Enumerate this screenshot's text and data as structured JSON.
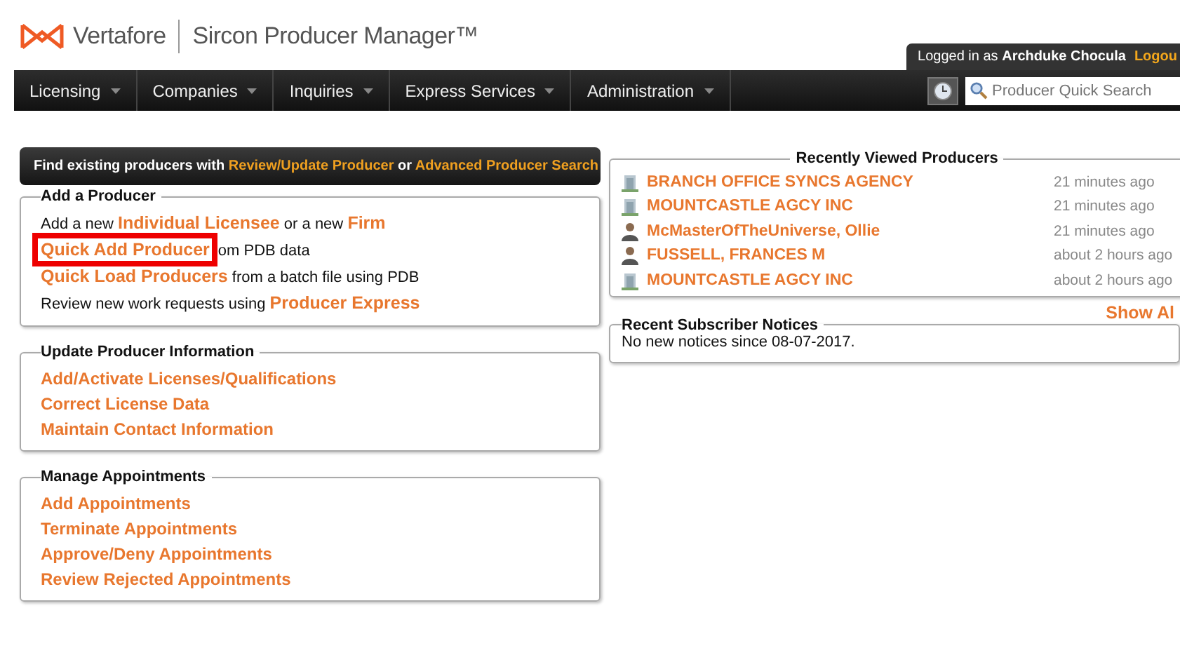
{
  "header": {
    "brand": "Vertafore",
    "product": "Sircon",
    "product_suffix": "Producer Manager",
    "trademark": "™",
    "login_prefix": "Logged in as",
    "user": "Archduke Chocula",
    "logout": "Logou"
  },
  "nav": [
    {
      "label": "Licensing"
    },
    {
      "label": "Companies"
    },
    {
      "label": "Inquiries"
    },
    {
      "label": "Express Services"
    },
    {
      "label": "Administration"
    }
  ],
  "search": {
    "placeholder": "Producer Quick Search"
  },
  "find_bar": {
    "parts": [
      {
        "kind": "text",
        "text": "Find existing producers with "
      },
      {
        "kind": "link",
        "text": "Review/Update Producer"
      },
      {
        "kind": "text",
        "text": " or "
      },
      {
        "kind": "link",
        "text": "Advanced Producer Search"
      }
    ]
  },
  "sections": [
    {
      "title": "Add a Producer",
      "lines": [
        {
          "parts": [
            {
              "kind": "text",
              "text": "Add a new "
            },
            {
              "kind": "link",
              "text": "Individual Licensee",
              "highlighted": false
            },
            {
              "kind": "text",
              "text": " or a new "
            },
            {
              "kind": "link",
              "text": "Firm",
              "highlighted": false
            }
          ]
        },
        {
          "parts": [
            {
              "kind": "link",
              "text": "Quick Add Producer",
              "highlighted": true
            },
            {
              "kind": "text",
              "text": "om PDB data"
            }
          ]
        },
        {
          "parts": [
            {
              "kind": "link",
              "text": "Quick Load Producers",
              "highlighted": false
            },
            {
              "kind": "text",
              "text": " from a batch file using PDB"
            }
          ]
        },
        {
          "parts": [
            {
              "kind": "text",
              "text": "Review new work requests using "
            },
            {
              "kind": "link",
              "text": "Producer Express",
              "highlighted": false
            }
          ]
        }
      ]
    },
    {
      "title": "Update Producer Information",
      "lines": [
        {
          "parts": [
            {
              "kind": "link",
              "text": "Add/Activate Licenses/Qualifications",
              "highlighted": false
            }
          ]
        },
        {
          "parts": [
            {
              "kind": "link",
              "text": "Correct License Data",
              "highlighted": false
            }
          ]
        },
        {
          "parts": [
            {
              "kind": "link",
              "text": "Maintain Contact Information",
              "highlighted": false
            }
          ]
        }
      ]
    },
    {
      "title": "Manage Appointments",
      "lines": [
        {
          "parts": [
            {
              "kind": "link",
              "text": "Add Appointments",
              "highlighted": false
            }
          ]
        },
        {
          "parts": [
            {
              "kind": "link",
              "text": "Terminate Appointments",
              "highlighted": false
            }
          ]
        },
        {
          "parts": [
            {
              "kind": "link",
              "text": "Approve/Deny Appointments",
              "highlighted": false
            }
          ]
        },
        {
          "parts": [
            {
              "kind": "link",
              "text": "Review Rejected Appointments",
              "highlighted": false
            }
          ]
        }
      ]
    }
  ],
  "recent": {
    "title": "Recently Viewed Producers",
    "items": [
      {
        "kind": "firm",
        "name": "BRANCH OFFICE SYNCS AGENCY",
        "time": "21 minutes ago"
      },
      {
        "kind": "firm",
        "name": "MOUNTCASTLE AGCY INC",
        "time": "21 minutes ago"
      },
      {
        "kind": "person",
        "name": "McMasterOfTheUniverse, Ollie",
        "time": "21 minutes ago"
      },
      {
        "kind": "person",
        "name": "FUSSELL, FRANCES M",
        "time": "about 2 hours ago"
      },
      {
        "kind": "firm",
        "name": "MOUNTCASTLE AGCY INC",
        "time": "about 2 hours ago"
      }
    ],
    "show_all": "Show Al"
  },
  "notices": {
    "title": "Recent Subscriber Notices",
    "text": "No new notices since 08-07-2017."
  }
}
